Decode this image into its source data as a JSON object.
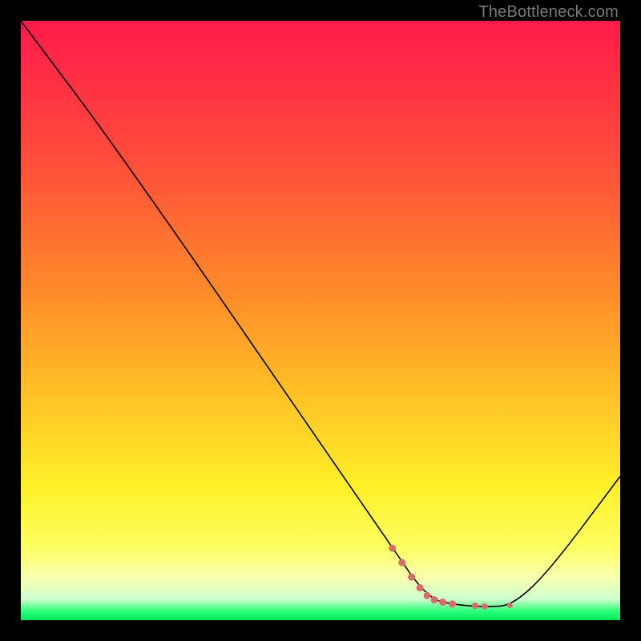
{
  "watermark": "TheBottleneck.com",
  "chart_data": {
    "type": "line",
    "title": "",
    "xlabel": "",
    "ylabel": "",
    "xlim": [
      0,
      100
    ],
    "ylim": [
      0,
      100
    ],
    "grid": false,
    "legend": false,
    "series": [
      {
        "name": "curve",
        "color": "#000000",
        "stroke_width": 1.6,
        "points": [
          {
            "x": 0,
            "y": 100
          },
          {
            "x": 18,
            "y": 76
          },
          {
            "x": 62,
            "y": 12
          },
          {
            "x": 68,
            "y": 3.5
          },
          {
            "x": 73,
            "y": 2.5
          },
          {
            "x": 78,
            "y": 2.2
          },
          {
            "x": 82,
            "y": 2.5
          },
          {
            "x": 88,
            "y": 8
          },
          {
            "x": 100,
            "y": 24
          }
        ]
      },
      {
        "name": "highlight-dots",
        "color": "#db6b6b",
        "type": "scatter",
        "points": [
          {
            "x": 62.0,
            "y": 12.0,
            "r": 4.5
          },
          {
            "x": 63.6,
            "y": 9.6,
            "r": 4.5
          },
          {
            "x": 65.2,
            "y": 7.2,
            "r": 4.5
          },
          {
            "x": 66.6,
            "y": 5.4,
            "r": 4.5
          },
          {
            "x": 67.8,
            "y": 4.1,
            "r": 4.5
          },
          {
            "x": 69.0,
            "y": 3.4,
            "r": 4.5
          },
          {
            "x": 70.4,
            "y": 3.0,
            "r": 4.5
          },
          {
            "x": 72.0,
            "y": 2.7,
            "r": 4.5
          },
          {
            "x": 75.8,
            "y": 2.4,
            "r": 4.2
          },
          {
            "x": 77.4,
            "y": 2.3,
            "r": 3.8
          },
          {
            "x": 81.6,
            "y": 2.5,
            "r": 3.4
          }
        ]
      }
    ],
    "gradient_stops": [
      {
        "offset": 0.0,
        "color": "#ff1a4a"
      },
      {
        "offset": 0.22,
        "color": "#ff4a3c"
      },
      {
        "offset": 0.45,
        "color": "#ff8a2a"
      },
      {
        "offset": 0.62,
        "color": "#ffc026"
      },
      {
        "offset": 0.78,
        "color": "#fff128"
      },
      {
        "offset": 0.88,
        "color": "#fdff63"
      },
      {
        "offset": 0.93,
        "color": "#f6ffb0"
      },
      {
        "offset": 0.965,
        "color": "#ceffce"
      },
      {
        "offset": 0.985,
        "color": "#2dff7a"
      },
      {
        "offset": 1.0,
        "color": "#00e85e"
      }
    ]
  }
}
